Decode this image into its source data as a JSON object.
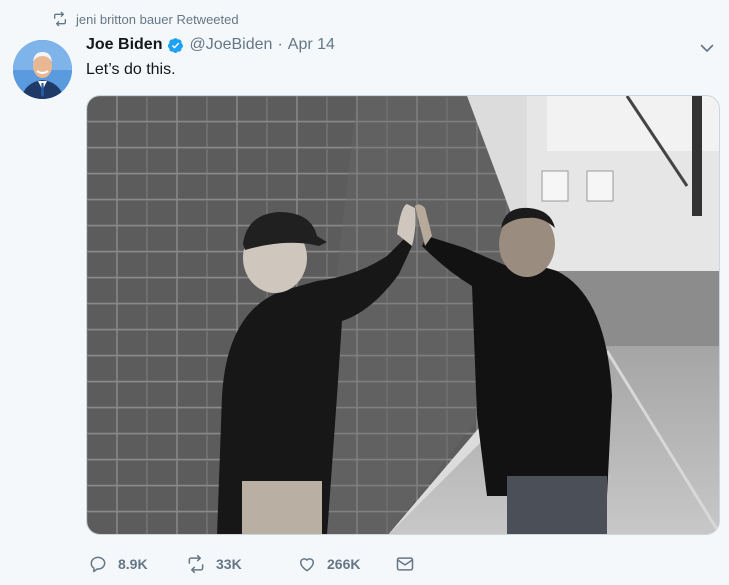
{
  "retweet_context": {
    "icon": "retweet-icon",
    "text": "jeni britton bauer Retweeted"
  },
  "tweet": {
    "author": {
      "name": "Joe Biden",
      "verified": true,
      "handle": "@JoeBiden"
    },
    "separator": "·",
    "date": "Apr 14",
    "text": "Let’s do this.",
    "image": {
      "subject": "photo-two-men-high-five-gym"
    },
    "actions": {
      "reply": {
        "icon": "reply-icon",
        "count": "8.9K"
      },
      "retweet": {
        "icon": "retweet-icon",
        "count": "33K"
      },
      "like": {
        "icon": "heart-icon",
        "count": "266K"
      },
      "dm": {
        "icon": "envelope-icon"
      }
    }
  },
  "colors": {
    "accent": "#1da1f2",
    "muted": "#657786",
    "text": "#14171a",
    "background": "#f5f8fa"
  }
}
